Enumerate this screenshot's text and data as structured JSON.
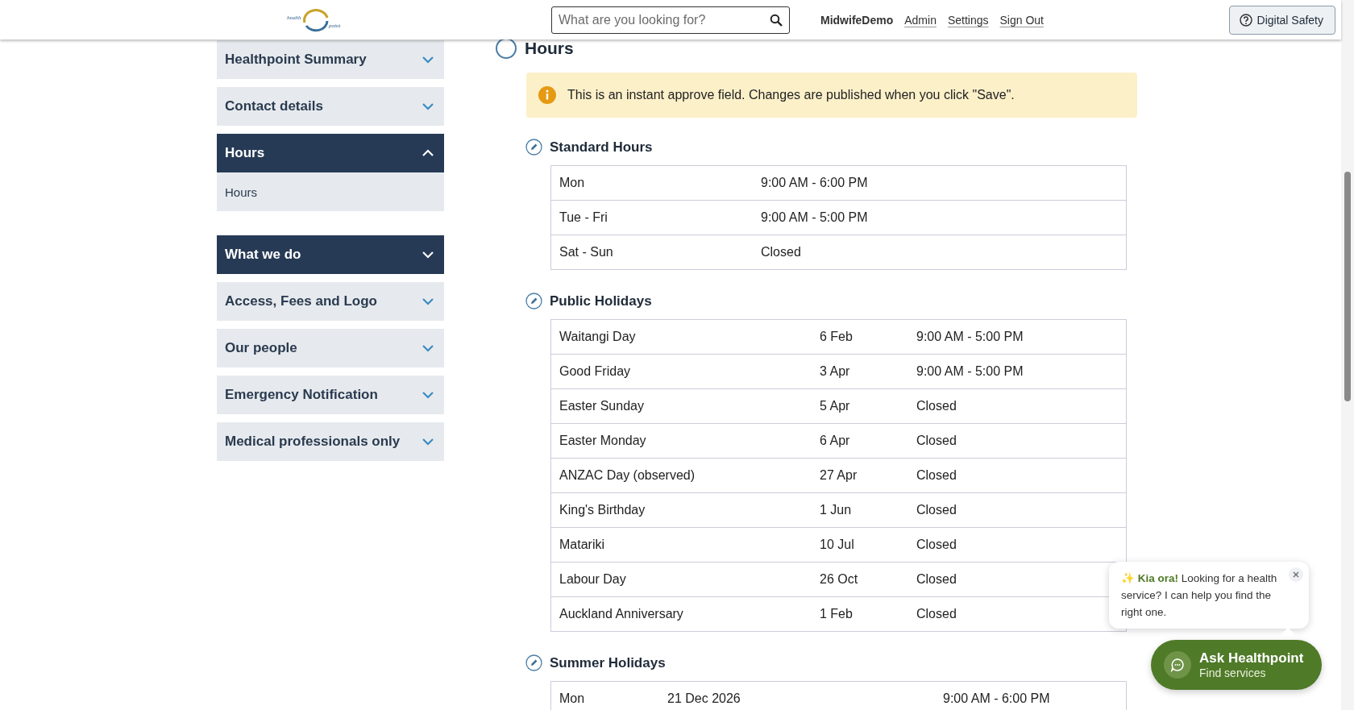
{
  "header": {
    "logo": [
      "health",
      "point"
    ],
    "search": {
      "placeholder": "What are you looking for?"
    },
    "user": "MidwifeDemo",
    "links": [
      "Admin",
      "Settings",
      "Sign Out"
    ],
    "safety_button": "Digital Safety"
  },
  "sidebar": {
    "items": [
      {
        "label": "Healthpoint Summary",
        "selected": false,
        "expanded": false
      },
      {
        "label": "Contact details",
        "selected": false,
        "expanded": false
      },
      {
        "label": "Hours",
        "selected": true,
        "expanded": true,
        "children": [
          {
            "label": "Hours"
          }
        ]
      },
      {
        "label": "What we do",
        "selected": true,
        "expanded": false
      },
      {
        "label": "Access, Fees and Logo",
        "selected": false,
        "expanded": false
      },
      {
        "label": "Our people",
        "selected": false,
        "expanded": false
      },
      {
        "label": "Emergency Notification",
        "selected": false,
        "expanded": false
      },
      {
        "label": "Medical professionals only",
        "selected": false,
        "expanded": false
      }
    ]
  },
  "main": {
    "title": "Hours",
    "notice": "This is an instant approve field. Changes are published when you click \"Save\".",
    "sections": [
      {
        "title": "Standard Hours",
        "rows": [
          [
            "Mon",
            "9:00 AM - 6:00 PM"
          ],
          [
            "Tue - Fri",
            "9:00 AM - 5:00 PM"
          ],
          [
            "Sat - Sun",
            "Closed"
          ]
        ]
      },
      {
        "title": "Public Holidays",
        "rows": [
          [
            "Waitangi Day",
            "6 Feb",
            "9:00 AM - 5:00 PM"
          ],
          [
            "Good Friday",
            "3 Apr",
            "9:00 AM - 5:00 PM"
          ],
          [
            "Easter Sunday",
            "5 Apr",
            "Closed"
          ],
          [
            "Easter Monday",
            "6 Apr",
            "Closed"
          ],
          [
            "ANZAC Day (observed)",
            "27 Apr",
            "Closed"
          ],
          [
            "King's Birthday",
            "1 Jun",
            "Closed"
          ],
          [
            "Matariki",
            "10 Jul",
            "Closed"
          ],
          [
            "Labour Day",
            "26 Oct",
            "Closed"
          ],
          [
            "Auckland Anniversary",
            "1 Feb",
            "Closed"
          ]
        ]
      },
      {
        "title": "Summer Holidays",
        "rows": [
          [
            "Mon",
            "21 Dec 2026",
            "9:00 AM - 6:00 PM"
          ]
        ]
      }
    ]
  },
  "chat": {
    "bubble": "✨ **Kia ora!** Looking for a health service? I can help you find the right one.",
    "button_title": "Ask Healthpoint",
    "button_subtitle": "Find services"
  }
}
